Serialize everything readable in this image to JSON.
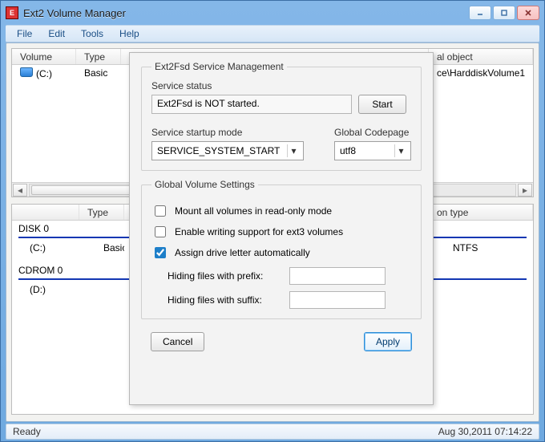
{
  "window": {
    "title": "Ext2 Volume Manager"
  },
  "menu": {
    "file": "File",
    "edit": "Edit",
    "tools": "Tools",
    "help": "Help"
  },
  "topList": {
    "columns": {
      "volume": "Volume",
      "type": "Type",
      "lastPartial": "al object"
    },
    "row1": {
      "volume": "(C:)",
      "type": "Basic",
      "objectTail": "ce\\HarddiskVolume1"
    }
  },
  "bottomList": {
    "columns": {
      "type": "Type",
      "partitionTail": "on type"
    },
    "disk0": {
      "label": "DISK 0",
      "volume": "(C:)",
      "type": "Basic",
      "parttype": "NTFS"
    },
    "cdrom0": {
      "label": "CDROM 0",
      "volume": "(D:)"
    }
  },
  "dialog": {
    "groupTitle": "Ext2Fsd Service Management",
    "status": {
      "label": "Service status",
      "value": "Ext2Fsd is NOT started.",
      "startBtn": "Start"
    },
    "startup": {
      "label": "Service startup mode",
      "selected": "SERVICE_SYSTEM_START",
      "codepageLabel": "Global Codepage",
      "codepageSelected": "utf8"
    },
    "globals": {
      "title": "Global Volume Settings",
      "readonly": "Mount all volumes in read-only mode",
      "ext3write": "Enable writing support for ext3 volumes",
      "autodrive": "Assign drive letter automatically",
      "readonlyChecked": false,
      "ext3writeChecked": false,
      "autodriveChecked": true,
      "prefixLabel": "Hiding files with prefix:",
      "suffixLabel": "Hiding files with suffix:",
      "prefixValue": "",
      "suffixValue": ""
    },
    "cancel": "Cancel",
    "apply": "Apply"
  },
  "status": {
    "left": "Ready",
    "right": "Aug 30,2011 07:14:22"
  }
}
